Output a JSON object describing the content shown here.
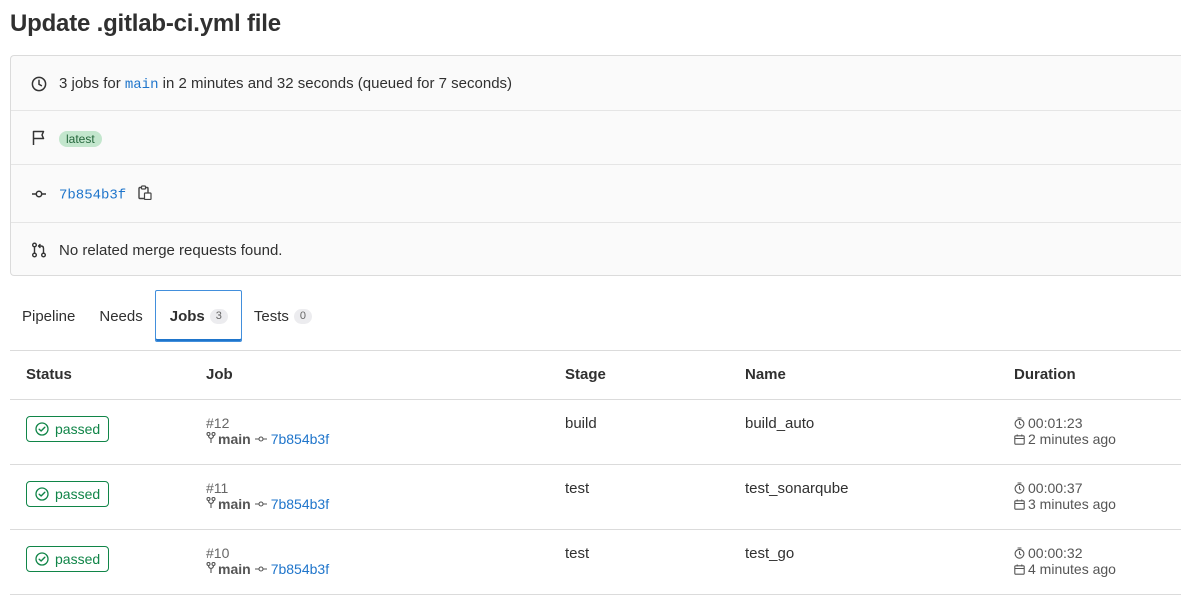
{
  "page_title": "Update .gitlab-ci.yml file",
  "info": {
    "jobs_prefix": "3 jobs for",
    "branch": "main",
    "jobs_suffix": "in 2 minutes and 32 seconds (queued for 7 seconds)",
    "latest_badge": "latest",
    "commit_sha": "7b854b3f",
    "merge_requests": "No related merge requests found."
  },
  "tabs": [
    {
      "label": "Pipeline"
    },
    {
      "label": "Needs"
    },
    {
      "label": "Jobs",
      "count": "3",
      "active": true
    },
    {
      "label": "Tests",
      "count": "0"
    }
  ],
  "table": {
    "headers": {
      "status": "Status",
      "job": "Job",
      "stage": "Stage",
      "name": "Name",
      "duration": "Duration"
    },
    "rows": [
      {
        "status": "passed",
        "job_id": "#12",
        "branch": "main",
        "sha": "7b854b3f",
        "stage": "build",
        "name": "build_auto",
        "duration": "00:01:23",
        "finished": "2 minutes ago"
      },
      {
        "status": "passed",
        "job_id": "#11",
        "branch": "main",
        "sha": "7b854b3f",
        "stage": "test",
        "name": "test_sonarqube",
        "duration": "00:00:37",
        "finished": "3 minutes ago"
      },
      {
        "status": "passed",
        "job_id": "#10",
        "branch": "main",
        "sha": "7b854b3f",
        "stage": "test",
        "name": "test_go",
        "duration": "00:00:32",
        "finished": "4 minutes ago"
      }
    ]
  },
  "colors": {
    "success": "#108548",
    "link": "#1f75cb",
    "latest_bg": "#c3e6cd",
    "tab_focus": "#428fdc"
  }
}
